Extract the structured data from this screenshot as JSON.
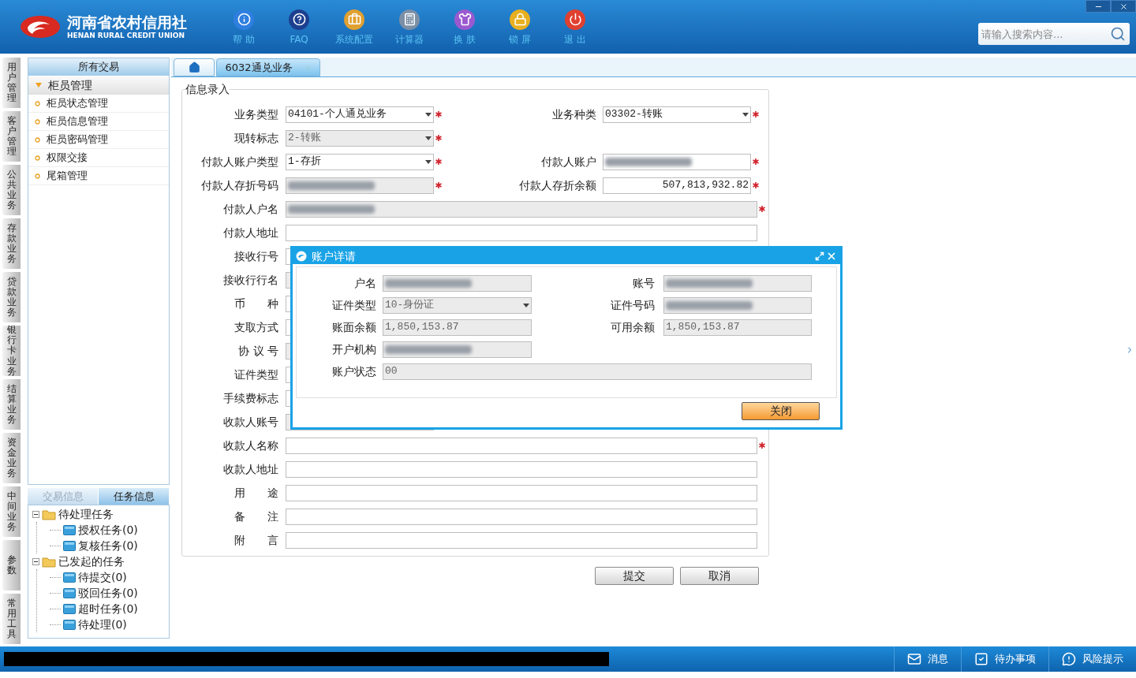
{
  "header": {
    "logo": {
      "title": "河南省农村信用社",
      "subtitle": "HENAN RURAL CREDIT UNION"
    },
    "toolbar": [
      {
        "kind": "info",
        "label": "帮 助"
      },
      {
        "kind": "faq",
        "label": "FAQ"
      },
      {
        "kind": "config",
        "label": "系统配置"
      },
      {
        "kind": "calculator",
        "label": "计算器"
      },
      {
        "kind": "skin",
        "label": "换 肤"
      },
      {
        "kind": "lock",
        "label": "锁 屏"
      },
      {
        "kind": "exit",
        "label": "退 出"
      }
    ],
    "search": {
      "placeholder": "请输入搜索内容..."
    }
  },
  "nav_tabs": [
    "用户管理",
    "客户管理",
    "公共业务",
    "存款业务",
    "贷款业务",
    "银行卡业务",
    "结算业务",
    "资金业务",
    "中间业务",
    "参数",
    "常用工具"
  ],
  "sidebar": {
    "header": "所有交易",
    "group": {
      "label": "柜员管理",
      "expanded": true,
      "items": [
        "柜员状态管理",
        "柜员信息管理",
        "柜员密码管理",
        "权限交接",
        "尾箱管理"
      ]
    },
    "bottom_tabs": [
      {
        "label": "交易信息",
        "selected": false
      },
      {
        "label": "任务信息",
        "selected": true
      }
    ],
    "tree": [
      {
        "label": "待处理任务",
        "expanded": true,
        "children": [
          {
            "label": "授权任务(0)"
          },
          {
            "label": "复核任务(0)"
          }
        ]
      },
      {
        "label": "已发起的任务",
        "expanded": true,
        "children": [
          {
            "label": "待提交(0)"
          },
          {
            "label": "驳回任务(0)"
          },
          {
            "label": "超时任务(0)"
          },
          {
            "label": "待处理(0)"
          }
        ]
      }
    ]
  },
  "tabs": [
    {
      "kind": "home",
      "selected": false
    },
    {
      "kind": "page",
      "label": "6032通兑业务",
      "selected": true
    }
  ],
  "form": {
    "legend": "信息录入",
    "rows": [
      [
        {
          "label": "业务类型",
          "kind": "select",
          "value": "04101-个人通兑业务",
          "disabled": false,
          "required": true
        },
        {
          "label": "业务种类",
          "kind": "select",
          "value": "03302-转账",
          "disabled": false,
          "required": true
        }
      ],
      [
        {
          "label": "现转标志",
          "kind": "select",
          "value": "2-转账",
          "disabled": true,
          "required": true
        }
      ],
      [
        {
          "label": "付款人账户类型",
          "kind": "select",
          "value": "1-存折",
          "disabled": false,
          "required": true
        },
        {
          "label": "付款人账户",
          "kind": "text",
          "redacted": true,
          "disabled": false,
          "required": true
        }
      ],
      [
        {
          "label": "付款人存折号码",
          "kind": "text",
          "redacted": true,
          "disabled": true,
          "required": true
        },
        {
          "label": "付款人存折余额",
          "kind": "amount",
          "value": "507,813,932.82",
          "disabled": false,
          "required": true
        }
      ],
      [
        {
          "label": "付款人户名",
          "kind": "text",
          "redacted": true,
          "disabled": true,
          "required": true,
          "wide": true
        }
      ],
      [
        {
          "label": "付款人地址",
          "kind": "text",
          "disabled": false,
          "required": false,
          "wide": true
        }
      ],
      [
        {
          "label": "接收行号",
          "kind": "text",
          "disabled": false,
          "required": false
        }
      ],
      [
        {
          "label": "接收行行名",
          "kind": "text",
          "disabled": true,
          "required": false
        }
      ],
      [
        {
          "label": "币　　种",
          "kind": "text",
          "disabled": false,
          "required": false
        }
      ],
      [
        {
          "label": "支取方式",
          "kind": "text",
          "disabled": false,
          "required": false
        }
      ],
      [
        {
          "label": "协 议 号",
          "kind": "text",
          "disabled": true,
          "required": false
        }
      ],
      [
        {
          "label": "证件类型",
          "kind": "text",
          "disabled": false,
          "required": false
        }
      ],
      [
        {
          "label": "手续费标志",
          "kind": "text",
          "disabled": false,
          "required": false
        }
      ],
      [
        {
          "label": "收款人账号",
          "kind": "text",
          "disabled": true,
          "required": false
        }
      ],
      [
        {
          "label": "收款人名称",
          "kind": "text",
          "disabled": false,
          "required": true,
          "wide": true
        }
      ],
      [
        {
          "label": "收款人地址",
          "kind": "text",
          "disabled": false,
          "required": false,
          "wide": true
        }
      ],
      [
        {
          "label": "用　　途",
          "kind": "text",
          "disabled": false,
          "required": false,
          "wide": true
        }
      ],
      [
        {
          "label": "备　　注",
          "kind": "text",
          "disabled": false,
          "required": false,
          "wide": true
        }
      ],
      [
        {
          "label": "附　　言",
          "kind": "text",
          "disabled": false,
          "required": false,
          "wide": true
        }
      ]
    ]
  },
  "buttons": [
    "提交",
    "取消"
  ],
  "dialog": {
    "title": "账户详请",
    "rows": [
      [
        {
          "label": "户名",
          "kind": "text",
          "redacted": true,
          "disabled": true
        },
        {
          "label": "账号",
          "kind": "text",
          "redacted": true,
          "disabled": true
        }
      ],
      [
        {
          "label": "证件类型",
          "kind": "select",
          "value": "10-身份证",
          "disabled": true
        },
        {
          "label": "证件号码",
          "kind": "text",
          "redacted": true,
          "disabled": true
        }
      ],
      [
        {
          "label": "账面余额",
          "kind": "text",
          "value": "1,850,153.87",
          "disabled": true
        },
        {
          "label": "可用余额",
          "kind": "text",
          "value": "1,850,153.87",
          "disabled": true
        }
      ],
      [
        {
          "label": "开户机构",
          "kind": "text",
          "redacted": true,
          "disabled": true
        }
      ],
      [
        {
          "label": "账户状态",
          "kind": "text",
          "value": "00",
          "disabled": true,
          "wide": true
        }
      ]
    ],
    "button": "关闭"
  },
  "status_bar": {
    "redacted": true,
    "items": [
      {
        "kind": "message",
        "label": "消息"
      },
      {
        "kind": "todo",
        "label": "待办事项"
      },
      {
        "kind": "risk",
        "label": "风险提示"
      }
    ]
  }
}
